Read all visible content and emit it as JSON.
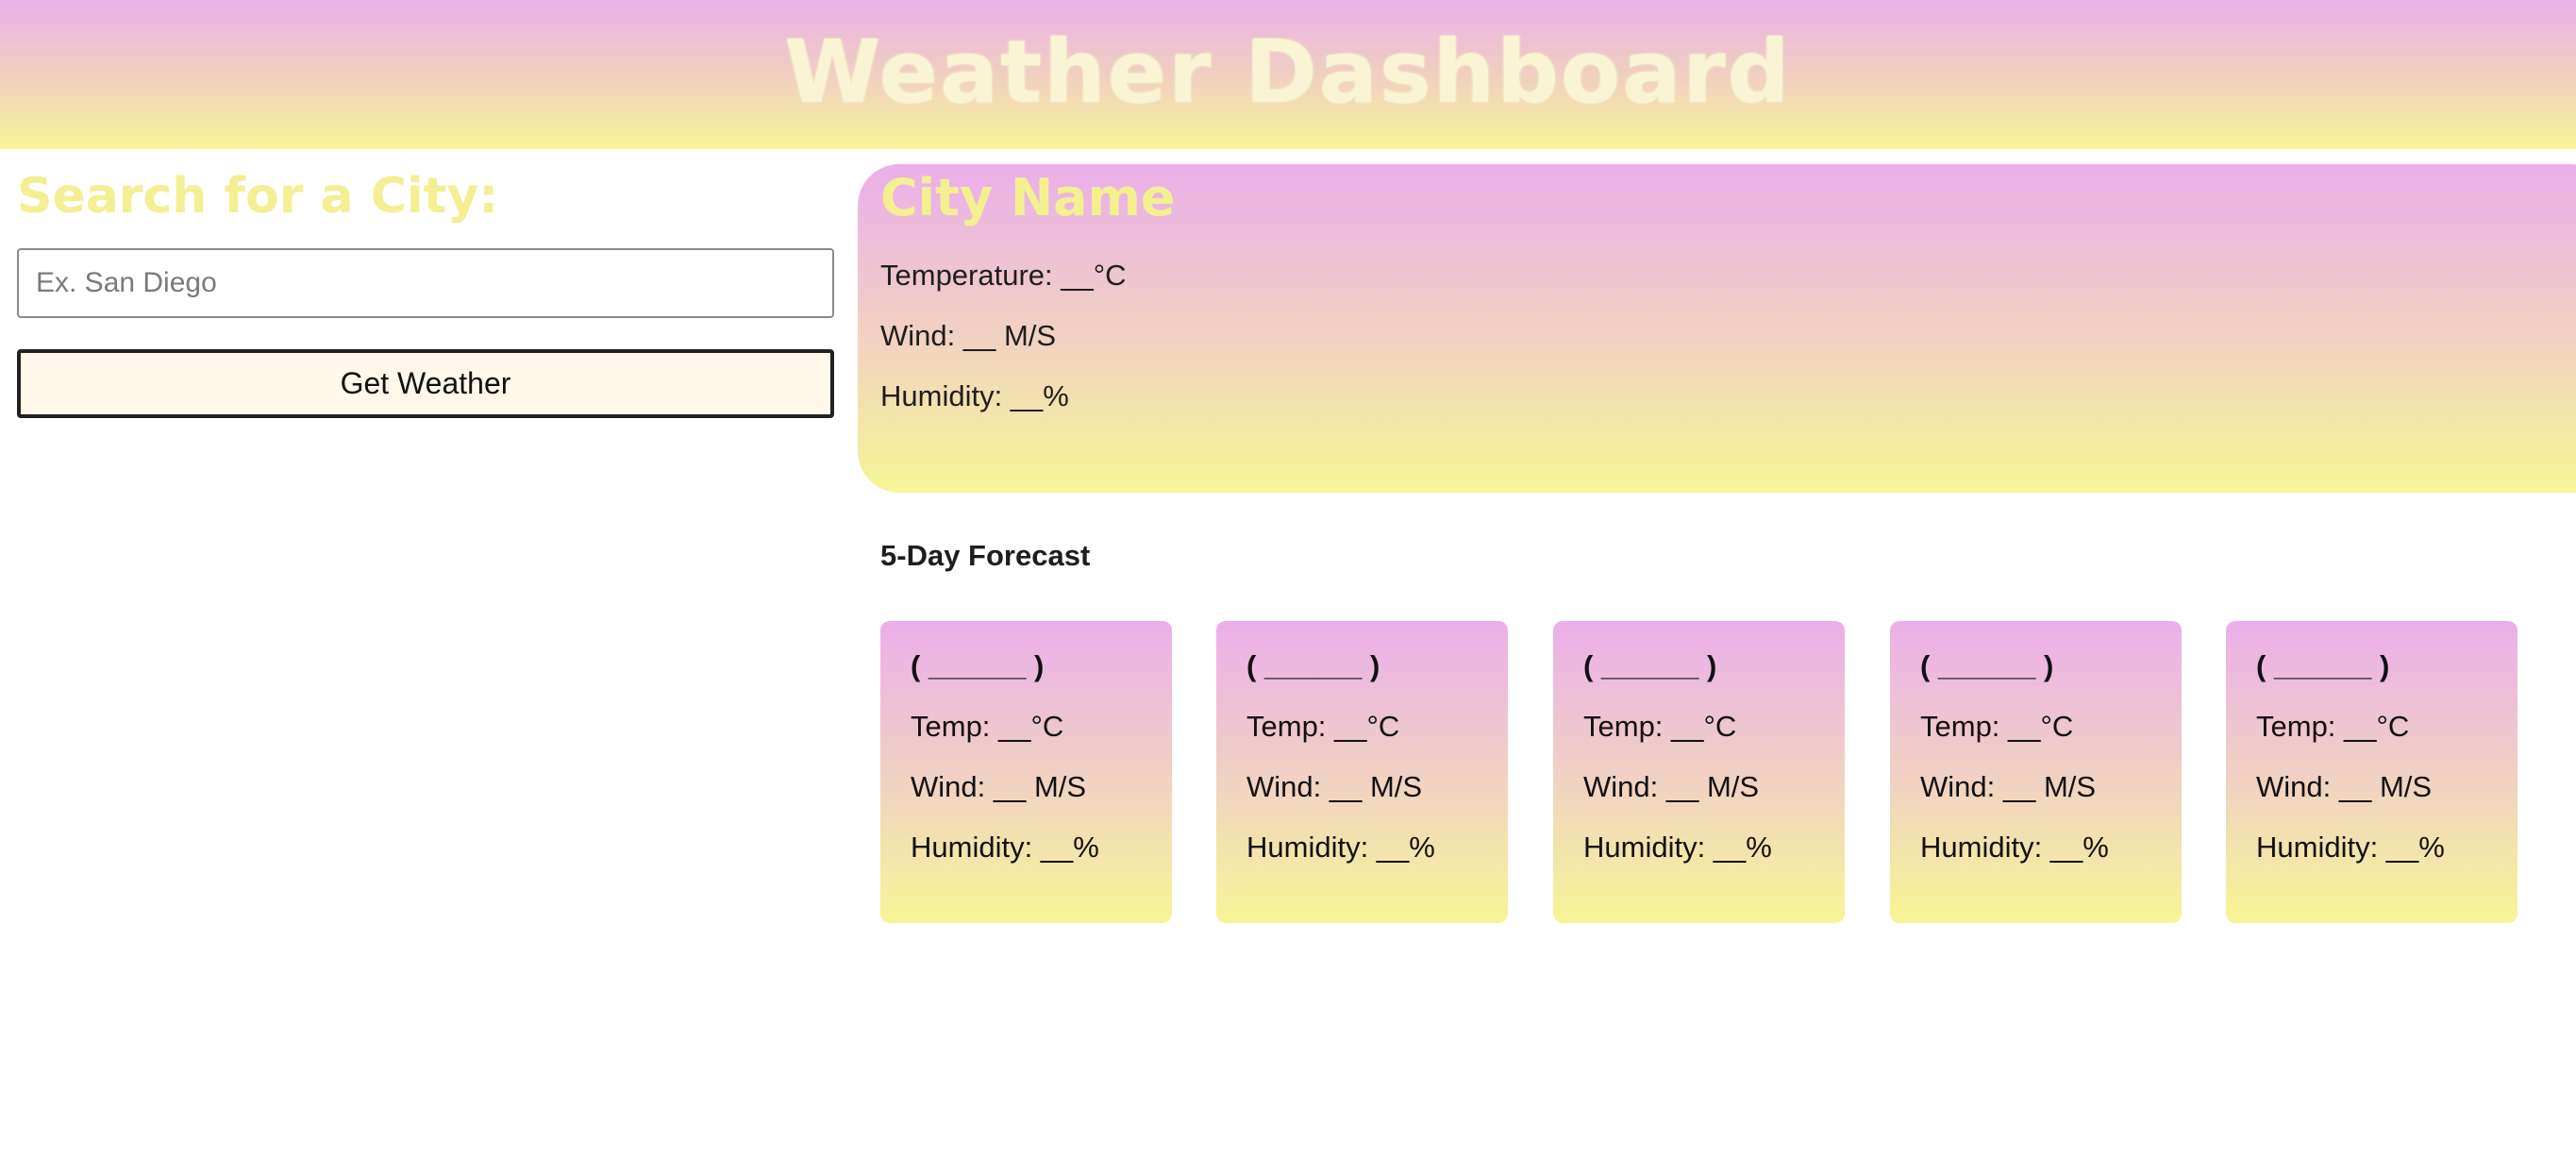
{
  "header": {
    "title": "Weather Dashboard"
  },
  "search": {
    "heading": "Search for a City:",
    "placeholder": "Ex. San Diego",
    "value": "",
    "button_label": "Get Weather"
  },
  "current": {
    "city": "City Name",
    "temperature": "Temperature: __°C",
    "wind": "Wind: __ M/S",
    "humidity": "Humidity: __%"
  },
  "forecast": {
    "heading": "5-Day Forecast",
    "days": [
      {
        "date": "( ______ )",
        "temp": "Temp: __°C",
        "wind": "Wind: __ M/S",
        "humidity": "Humidity: __%"
      },
      {
        "date": "( ______ )",
        "temp": "Temp: __°C",
        "wind": "Wind: __ M/S",
        "humidity": "Humidity: __%"
      },
      {
        "date": "( ______ )",
        "temp": "Temp: __°C",
        "wind": "Wind: __ M/S",
        "humidity": "Humidity: __%"
      },
      {
        "date": "( ______ )",
        "temp": "Temp: __°C",
        "wind": "Wind: __ M/S",
        "humidity": "Humidity: __%"
      },
      {
        "date": "( ______ )",
        "temp": "Temp: __°C",
        "wind": "Wind: __ M/S",
        "humidity": "Humidity: __%"
      }
    ]
  },
  "colors": {
    "gradient_top": "#eab0ea",
    "gradient_bottom": "#f6f39a",
    "heading_yellow": "#f3ef92",
    "title_cream": "#f8f4d4",
    "button_bg": "#fef7ea"
  }
}
